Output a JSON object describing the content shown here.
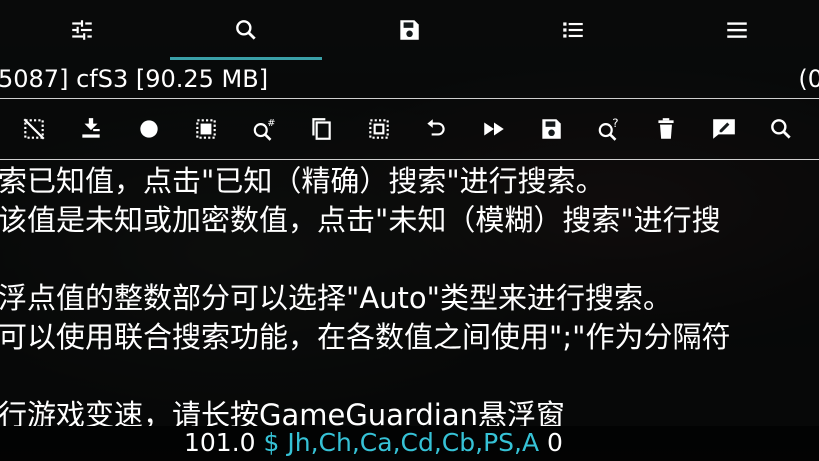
{
  "tabs": [
    {
      "icon": "settings-sliders-icon",
      "active": false
    },
    {
      "icon": "search-icon",
      "active": true
    },
    {
      "icon": "save-icon",
      "active": false
    },
    {
      "icon": "list-icon",
      "active": false
    },
    {
      "icon": "menu-icon",
      "active": false
    }
  ],
  "process": {
    "text": "5087] cfS3 [90.25 MB]",
    "right_text": "(0"
  },
  "toolbar_icons": [
    "select-none-icon",
    "import-icon",
    "record-icon",
    "select-all-icon",
    "search-hash-icon",
    "copy-icon",
    "select-inverse-icon",
    "undo-icon",
    "fast-forward-icon",
    "save-icon",
    "search-unknown-icon",
    "delete-icon",
    "edit-comment-icon",
    "search-icon"
  ],
  "help_lines": [
    "索已知值，点击\"已知（精确）搜索\"进行搜索。",
    "该值是未知或加密数值，点击\"未知（模糊）搜索\"进行搜",
    "",
    "浮点值的整数部分可以选择\"Auto\"类型来进行搜索。",
    "可以使用联合搜索功能，在各数值之间使用\";\"作为分隔符",
    "",
    "行游戏变速，请长按GameGuardian悬浮窗"
  ],
  "status": {
    "value": "101.0",
    "dollar": "$",
    "types": "Jh,Ch,Ca,Cd,Cb,PS,A",
    "count": "0"
  },
  "colors": {
    "accent": "#3aa0a8",
    "type_color": "#36c2d6"
  }
}
